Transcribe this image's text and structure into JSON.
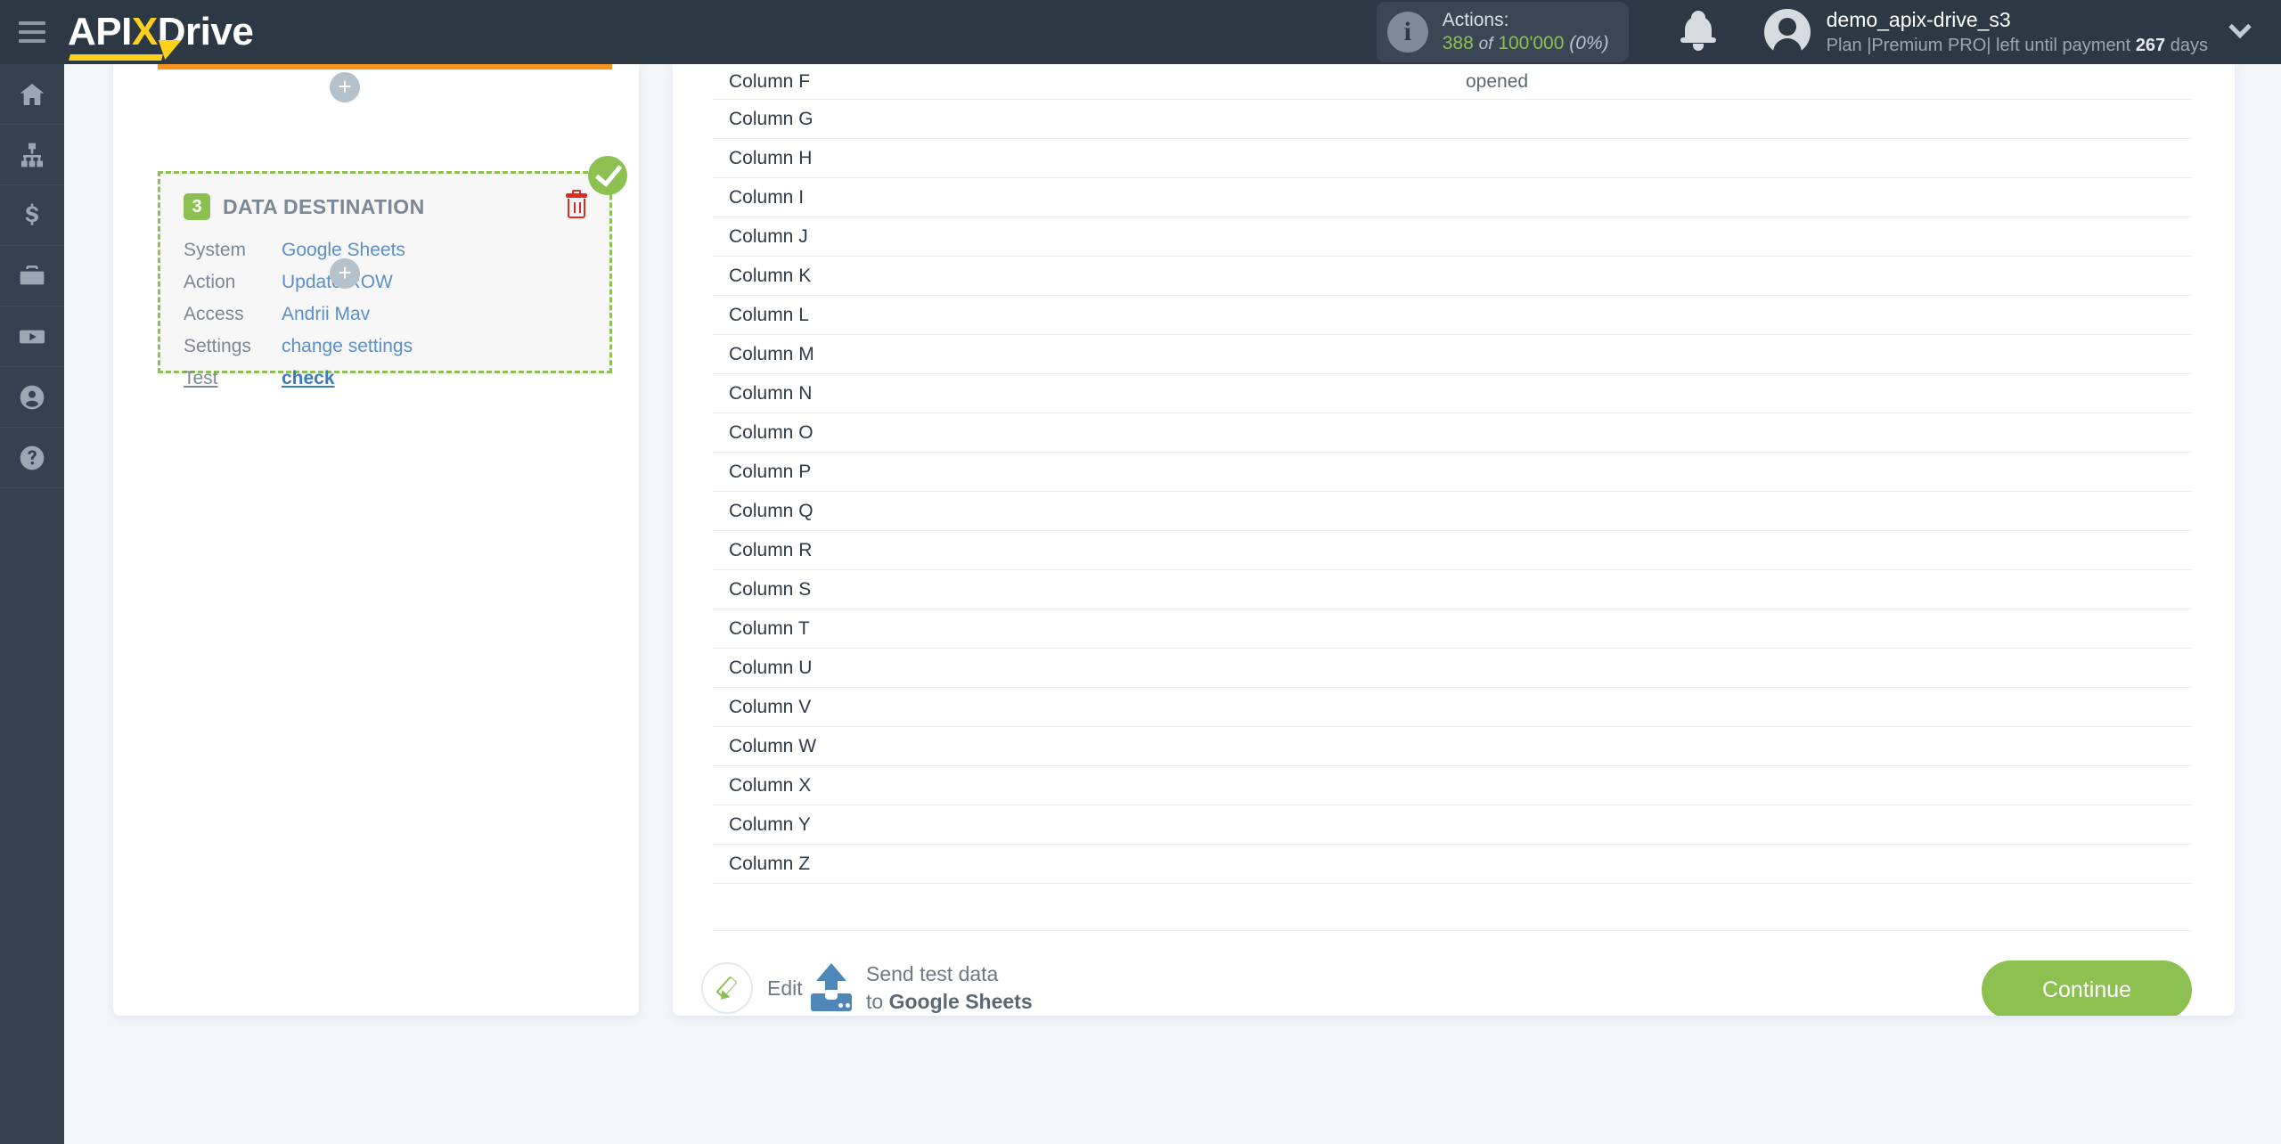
{
  "brand": {
    "name_part1": "API",
    "name_x": "X",
    "name_part2": "Drive"
  },
  "header": {
    "actions_label": "Actions:",
    "actions_used": "388",
    "actions_of": "of",
    "actions_total": "100'000",
    "actions_percent": "(0%)",
    "bell_icon": "bell-icon",
    "user_name": "demo_apix-drive_s3",
    "plan_prefix": "Plan |Premium PRO| left until payment",
    "plan_days": "267",
    "plan_suffix": "days",
    "chevron_icon": "chevron-down-icon",
    "menu_icon": "hamburger-menu-icon"
  },
  "rail": {
    "items": [
      {
        "name": "sidebar-item-home",
        "icon": "home-icon"
      },
      {
        "name": "sidebar-item-connections",
        "icon": "sitemap-icon"
      },
      {
        "name": "sidebar-item-billing",
        "icon": "dollar-icon"
      },
      {
        "name": "sidebar-item-business",
        "icon": "briefcase-icon"
      },
      {
        "name": "sidebar-item-video",
        "icon": "youtube-icon"
      },
      {
        "name": "sidebar-item-account",
        "icon": "user-circle-icon"
      },
      {
        "name": "sidebar-item-help",
        "icon": "question-circle-icon"
      }
    ]
  },
  "step": {
    "number": "3",
    "title": "DATA DESTINATION",
    "delete_icon": "trash-icon",
    "status_icon": "check-circle-icon",
    "rows": [
      {
        "key": "System",
        "value": "Google Sheets"
      },
      {
        "key": "Action",
        "value": "Update ROW"
      },
      {
        "key": "Access",
        "value": "Andrii Mav"
      },
      {
        "key": "Settings",
        "value": "change settings"
      }
    ],
    "test_key": "Test",
    "test_value": "check",
    "add_button_label": "+"
  },
  "table": {
    "rows": [
      {
        "name": "Column F",
        "value": "opened"
      },
      {
        "name": "Column G",
        "value": ""
      },
      {
        "name": "Column H",
        "value": ""
      },
      {
        "name": "Column I",
        "value": ""
      },
      {
        "name": "Column J",
        "value": ""
      },
      {
        "name": "Column K",
        "value": ""
      },
      {
        "name": "Column L",
        "value": ""
      },
      {
        "name": "Column M",
        "value": ""
      },
      {
        "name": "Column N",
        "value": ""
      },
      {
        "name": "Column O",
        "value": ""
      },
      {
        "name": "Column P",
        "value": ""
      },
      {
        "name": "Column Q",
        "value": ""
      },
      {
        "name": "Column R",
        "value": ""
      },
      {
        "name": "Column S",
        "value": ""
      },
      {
        "name": "Column T",
        "value": ""
      },
      {
        "name": "Column U",
        "value": ""
      },
      {
        "name": "Column V",
        "value": ""
      },
      {
        "name": "Column W",
        "value": ""
      },
      {
        "name": "Column X",
        "value": ""
      },
      {
        "name": "Column Y",
        "value": ""
      },
      {
        "name": "Column Z",
        "value": ""
      }
    ]
  },
  "footer": {
    "edit_label": "Edit",
    "edit_icon": "pencil-icon",
    "upload_icon": "upload-icon",
    "send_line1": "Send test data",
    "send_line2_prefix": "to",
    "send_line2_target": "Google Sheets",
    "continue_label": "Continue"
  },
  "colors": {
    "topbar": "#2d3845",
    "rail": "#344150",
    "accent_green": "#8cc152",
    "accent_yellow": "#ffd11a",
    "accent_orange": "#f7941e",
    "link_blue": "#5b8fc9",
    "danger_red": "#e02b20",
    "page_bg": "#f2f5fa"
  }
}
